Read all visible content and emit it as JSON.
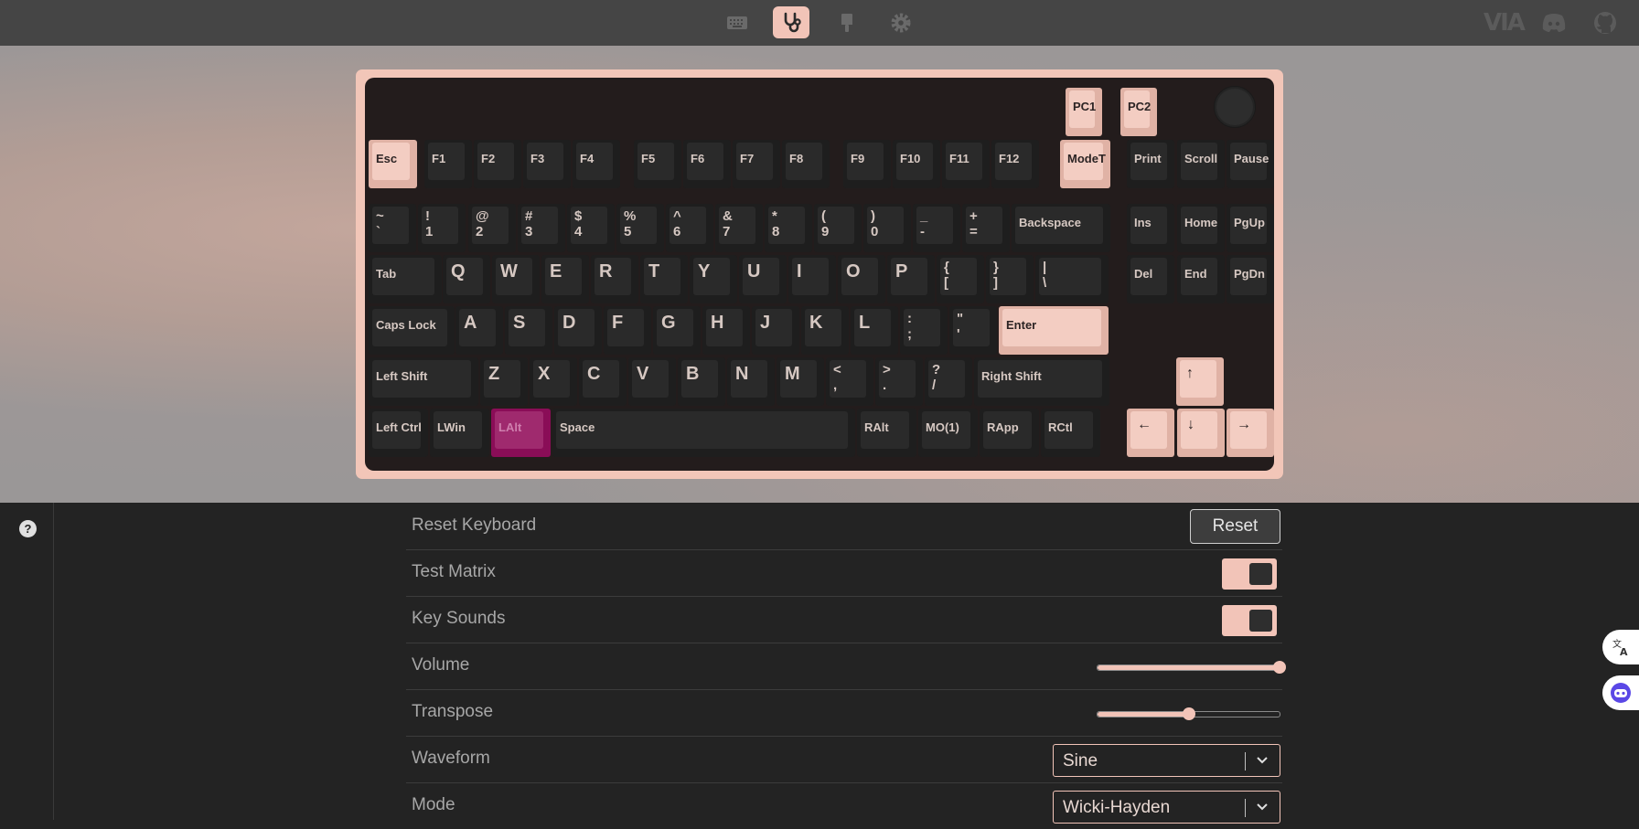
{
  "top_nav": {
    "items": [
      {
        "name": "keyboard-icon",
        "active": false
      },
      {
        "name": "stethoscope-icon",
        "active": true
      },
      {
        "name": "paintbrush-icon",
        "active": false
      },
      {
        "name": "gear-icon",
        "active": false
      }
    ],
    "logo_text": "VIA",
    "right_icons": [
      "discord-icon",
      "github-icon"
    ]
  },
  "keyboard": {
    "top_keys": [
      {
        "label": "PC1",
        "style": "light"
      },
      {
        "label": "PC2",
        "style": "light"
      }
    ],
    "rows": [
      [
        {
          "label": "Esc",
          "style": "light"
        },
        {
          "label": "F1"
        },
        {
          "label": "F2"
        },
        {
          "label": "F3"
        },
        {
          "label": "F4"
        },
        {
          "label": "F5"
        },
        {
          "label": "F6"
        },
        {
          "label": "F7"
        },
        {
          "label": "F8"
        },
        {
          "label": "F9"
        },
        {
          "label": "F10"
        },
        {
          "label": "F11"
        },
        {
          "label": "F12"
        },
        {
          "label": "ModeT",
          "style": "light"
        },
        {
          "label": "Print"
        },
        {
          "label": "Scroll"
        },
        {
          "label": "Pause"
        }
      ],
      [
        {
          "label": "~\n`"
        },
        {
          "label": "!\n1"
        },
        {
          "label": "@\n2"
        },
        {
          "label": "#\n3"
        },
        {
          "label": "$\n4"
        },
        {
          "label": "%\n5"
        },
        {
          "label": "^\n6"
        },
        {
          "label": "&\n7"
        },
        {
          "label": "*\n8"
        },
        {
          "label": "(\n9"
        },
        {
          "label": ")\n0"
        },
        {
          "label": "_\n-"
        },
        {
          "label": "+\n="
        },
        {
          "label": "Backspace"
        },
        {
          "label": "Ins"
        },
        {
          "label": "Home"
        },
        {
          "label": "PgUp"
        }
      ],
      [
        {
          "label": "Tab"
        },
        {
          "label": "Q"
        },
        {
          "label": "W"
        },
        {
          "label": "E"
        },
        {
          "label": "R"
        },
        {
          "label": "T"
        },
        {
          "label": "Y"
        },
        {
          "label": "U"
        },
        {
          "label": "I"
        },
        {
          "label": "O"
        },
        {
          "label": "P"
        },
        {
          "label": "{\n["
        },
        {
          "label": "}\n]"
        },
        {
          "label": "|\n\\"
        },
        {
          "label": "Del"
        },
        {
          "label": "End"
        },
        {
          "label": "PgDn"
        }
      ],
      [
        {
          "label": "Caps Lock"
        },
        {
          "label": "A"
        },
        {
          "label": "S"
        },
        {
          "label": "D"
        },
        {
          "label": "F"
        },
        {
          "label": "G"
        },
        {
          "label": "H"
        },
        {
          "label": "J"
        },
        {
          "label": "K"
        },
        {
          "label": "L"
        },
        {
          "label": ":\n;"
        },
        {
          "label": "\"\n'"
        },
        {
          "label": "Enter",
          "style": "light"
        }
      ],
      [
        {
          "label": "Left Shift"
        },
        {
          "label": "Z"
        },
        {
          "label": "X"
        },
        {
          "label": "C"
        },
        {
          "label": "V"
        },
        {
          "label": "B"
        },
        {
          "label": "N"
        },
        {
          "label": "M"
        },
        {
          "label": "<\n,"
        },
        {
          "label": ">\n."
        },
        {
          "label": "?\n/"
        },
        {
          "label": "Right Shift"
        },
        {
          "label": "↑",
          "style": "light"
        }
      ],
      [
        {
          "label": "Left Ctrl"
        },
        {
          "label": "LWin"
        },
        {
          "label": "LAlt",
          "style": "magenta"
        },
        {
          "label": "Space"
        },
        {
          "label": "RAlt"
        },
        {
          "label": "MO(1)"
        },
        {
          "label": "RApp"
        },
        {
          "label": "RCtl"
        },
        {
          "label": "←",
          "style": "light"
        },
        {
          "label": "↓",
          "style": "light"
        },
        {
          "label": "→",
          "style": "light"
        }
      ]
    ]
  },
  "settings": {
    "reset_keyboard": {
      "label": "Reset Keyboard",
      "button": "Reset"
    },
    "test_matrix": {
      "label": "Test Matrix",
      "enabled": true
    },
    "key_sounds": {
      "label": "Key Sounds",
      "enabled": true
    },
    "volume": {
      "label": "Volume",
      "value": 1.0
    },
    "transpose": {
      "label": "Transpose",
      "value": 0.5
    },
    "waveform": {
      "label": "Waveform",
      "value": "Sine"
    },
    "mode": {
      "label": "Mode",
      "value": "Wicki-Hayden"
    }
  },
  "sidebar": {
    "help_glyph": "?"
  },
  "colors": {
    "accent": "#f2c4b8",
    "highlight": "#9f2a6e",
    "background": "#232323"
  }
}
